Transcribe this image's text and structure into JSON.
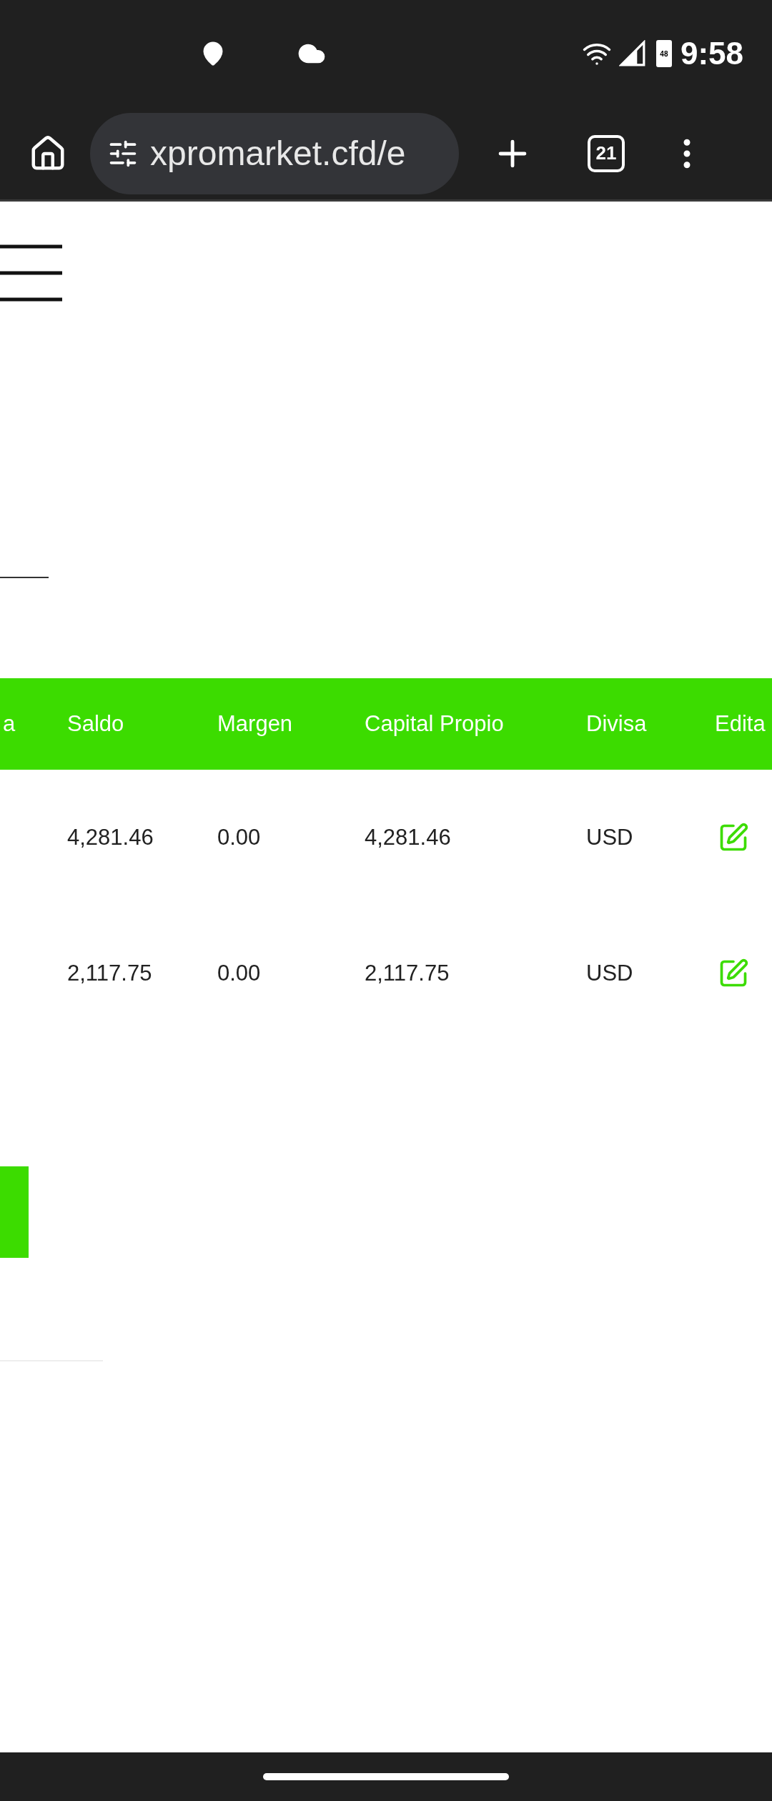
{
  "status_bar": {
    "time": "9:58",
    "battery": "48"
  },
  "browser": {
    "url": "xpromarket.cfd/e",
    "tab_count": "21"
  },
  "table": {
    "columns": [
      "a",
      "Saldo",
      "Margen",
      "Capital Propio",
      "Divisa",
      "Edita"
    ],
    "rows": [
      {
        "cells": [
          "",
          "4,281.46",
          "0.00",
          "4,281.46",
          "USD"
        ]
      },
      {
        "cells": [
          "",
          "2,117.75",
          "0.00",
          "2,117.75",
          "USD"
        ]
      }
    ]
  }
}
